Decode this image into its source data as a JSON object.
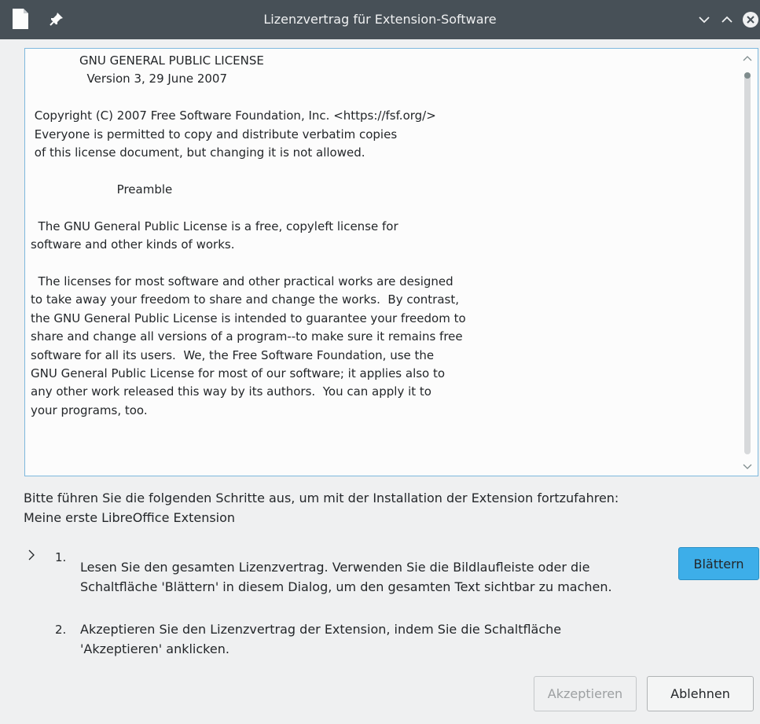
{
  "window": {
    "title": "Lizenzvertrag für Extension-Software"
  },
  "license": {
    "lines": [
      "             GNU GENERAL PUBLIC LICENSE",
      "               Version 3, 29 June 2007",
      "",
      " Copyright (C) 2007 Free Software Foundation, Inc. <https://fsf.org/>",
      " Everyone is permitted to copy and distribute verbatim copies",
      " of this license document, but changing it is not allowed.",
      "",
      "                       Preamble",
      "",
      "  The GNU General Public License is a free, copyleft license for",
      "software and other kinds of works.",
      "",
      "  The licenses for most software and other practical works are designed",
      "to take away your freedom to share and change the works.  By contrast,",
      "the GNU General Public License is intended to guarantee your freedom to",
      "share and change all versions of a program--to make sure it remains free",
      "software for all its users.  We, the Free Software Foundation, use the",
      "GNU General Public License for most of our software; it applies also to",
      "any other work released this way by its authors.  You can apply it to",
      "your programs, too."
    ]
  },
  "instructions": {
    "line1": "Bitte führen Sie die folgenden Schritte aus, um mit der Installation der Extension fortzufahren:",
    "line2": "Meine erste LibreOffice Extension"
  },
  "steps": [
    {
      "number": "1.",
      "text": "Lesen Sie den gesamten Lizenzvertrag. Verwenden Sie die Bildlaufleiste oder die\nSchaltfläche 'Blättern' in diesem Dialog, um den gesamten Text sichtbar zu machen.",
      "current": true
    },
    {
      "number": "2.",
      "text": "Akzeptieren Sie den Lizenzvertrag der Extension, indem Sie die Schaltfläche\n'Akzeptieren' anklicken.",
      "current": false
    }
  ],
  "buttons": {
    "scroll": "Blättern",
    "accept": "Akzeptieren",
    "decline": "Ablehnen"
  },
  "colors": {
    "titlebar": "#475057",
    "accent": "#3daee9",
    "close": "#da4453"
  },
  "icons": {
    "app": "document-icon",
    "pin": "pin-icon",
    "minimize": "chevron-down-icon",
    "maximize": "chevron-up-icon",
    "close": "close-icon",
    "step_indicator": "chevron-right-icon"
  }
}
